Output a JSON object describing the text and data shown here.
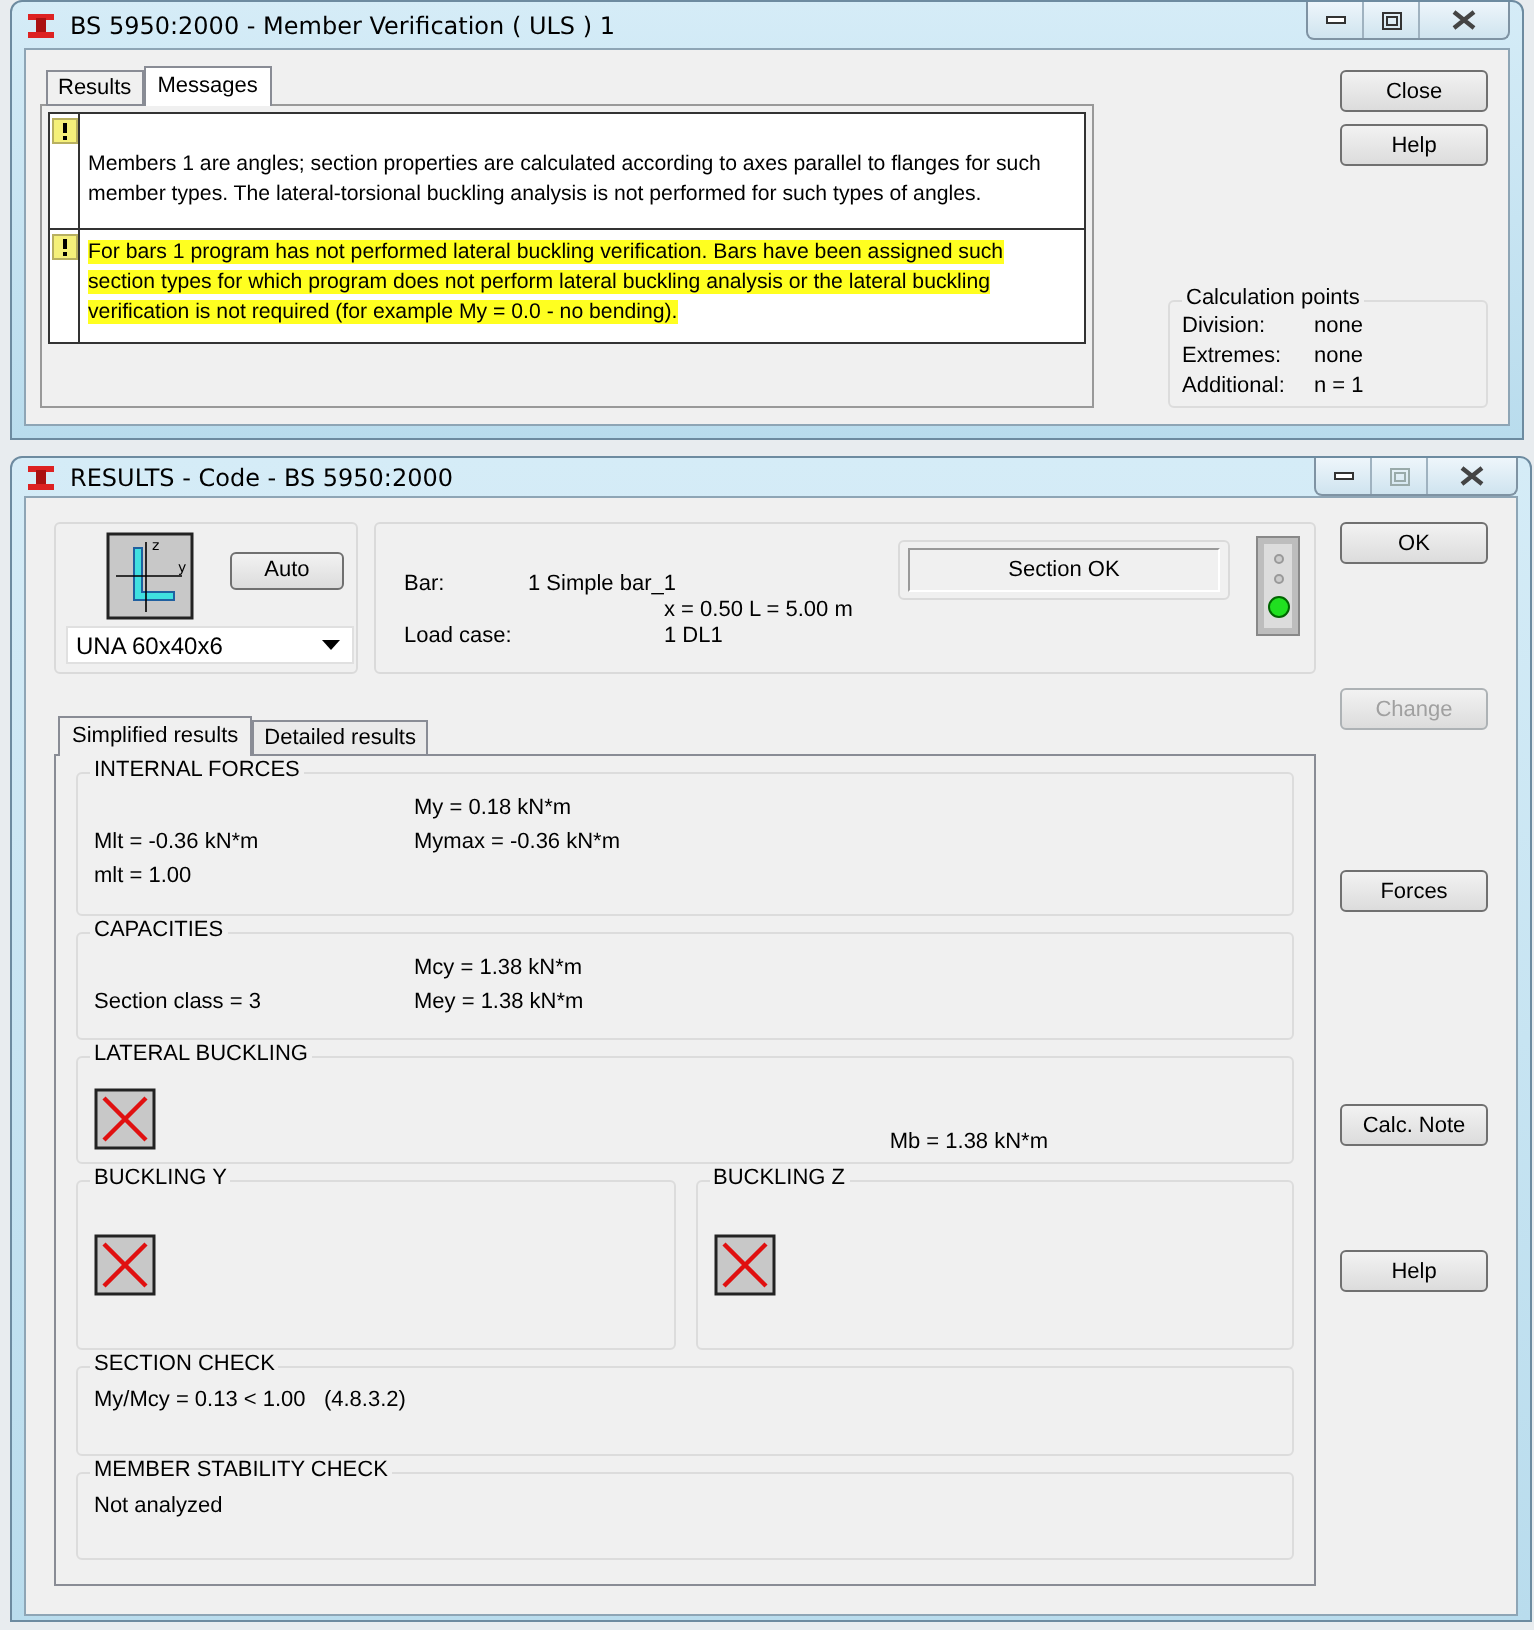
{
  "verification_window": {
    "title": "BS 5950:2000 - Member Verification ( ULS ) 1",
    "tabs": [
      {
        "label": "Results",
        "selected": false
      },
      {
        "label": "Messages",
        "selected": true
      }
    ],
    "messages": [
      {
        "text": "Members 1 are angles; section properties are calculated according to axes parallel to flanges for such member types. The lateral-torsional buckling analysis is not performed for such types of angles.",
        "highlighted": false
      },
      {
        "text": "For bars 1 program has not performed lateral buckling verification. Bars have been assigned such section types for which program does not perform lateral buckling analysis or the lateral buckling verification is not required (for example My = 0.0 - no bending).",
        "highlighted": true
      }
    ],
    "buttons": [
      {
        "label": "Close",
        "disabled": false
      },
      {
        "label": "Help",
        "disabled": false
      }
    ],
    "calculation_points": {
      "title": "Calculation points",
      "rows": [
        {
          "label": "Division:",
          "value": "none"
        },
        {
          "label": "Extremes:",
          "value": "none"
        },
        {
          "label": "Additional:",
          "value": "n = 1"
        }
      ]
    }
  },
  "results_window": {
    "title": "RESULTS - Code - BS 5950:2000",
    "section": {
      "axis_labels": [
        "z",
        "y"
      ],
      "auto_button": "Auto",
      "profile": "UNA 60x40x6"
    },
    "info": {
      "bar_label": "Bar:",
      "bar_value": "1  Simple bar_1",
      "position": "x = 0.50 L = 5.00 m",
      "load_case_label": "Load case:",
      "load_case_value": "1 DL1"
    },
    "status": {
      "text": "Section OK",
      "lamps": [
        {
          "on": false
        },
        {
          "on": false
        },
        {
          "on": true
        }
      ]
    },
    "buttons": [
      {
        "label": "OK",
        "disabled": false
      },
      {
        "label": "Change",
        "disabled": true
      },
      {
        "label": "Forces",
        "disabled": false
      },
      {
        "label": "Calc. Note",
        "disabled": false
      },
      {
        "label": "Help",
        "disabled": false
      }
    ],
    "tabs": [
      {
        "label": "Simplified results",
        "selected": true
      },
      {
        "label": "Detailed results",
        "selected": false
      }
    ],
    "panels": [
      {
        "kind": "values",
        "title": "INTERNAL FORCES",
        "rows": [
          {
            "right": "My = 0.18 kN*m"
          },
          {
            "left": "Mlt = -0.36 kN*m",
            "right": "Mymax = -0.36 kN*m"
          },
          {
            "left": "mlt = 1.00"
          }
        ]
      },
      {
        "kind": "values",
        "title": "CAPACITIES",
        "rows": [
          {
            "right": "Mcy = 1.38 kN*m"
          },
          {
            "left": "Section class = 3",
            "right": "Mey = 1.38 kN*m"
          }
        ]
      },
      {
        "kind": "buckling",
        "title": "LATERAL BUCKLING",
        "failed": true,
        "value": "Mb = 1.38 kN*m"
      },
      {
        "kind": "pair",
        "panels": [
          {
            "title": "BUCKLING Y",
            "failed": true
          },
          {
            "title": "BUCKLING Z",
            "failed": true
          }
        ]
      },
      {
        "kind": "text",
        "title": "SECTION CHECK",
        "text": "My/Mcy = 0.13 < 1.00   (4.8.3.2)"
      },
      {
        "kind": "text",
        "title": "MEMBER STABILITY CHECK",
        "text": "Not analyzed"
      }
    ]
  }
}
